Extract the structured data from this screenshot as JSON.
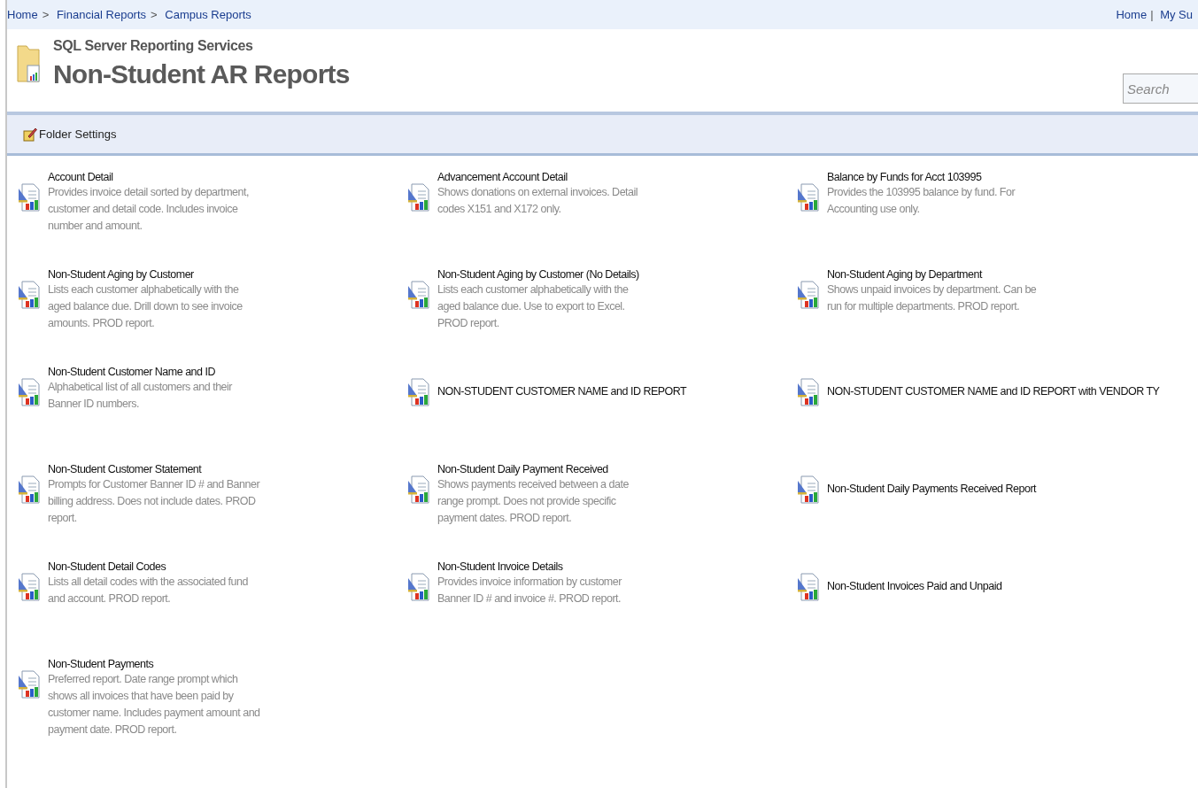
{
  "breadcrumb": [
    {
      "label": "Home"
    },
    {
      "label": "Financial Reports"
    },
    {
      "label": "Campus Reports"
    }
  ],
  "breadcrumb_separator": ">",
  "top_links": [
    {
      "label": "Home"
    },
    {
      "label": "My Su"
    }
  ],
  "top_link_separator": "|",
  "header": {
    "subtitle": "SQL Server Reporting Services",
    "title": "Non-Student AR Reports"
  },
  "search": {
    "placeholder": "Search"
  },
  "toolbar": {
    "button": "Folder Settings"
  },
  "reports": [
    {
      "name": "Account Detail",
      "description": "Provides invoice detail sorted by department, customer and detail code. Includes invoice number and amount."
    },
    {
      "name": "Advancement Account Detail",
      "description": "Shows donations on external invoices. Detail codes X151 and X172 only."
    },
    {
      "name": "Balance by Funds for Acct 103995",
      "description": "Provides the 103995 balance by fund. For Accounting use only."
    },
    {
      "name": "Non-Student Aging by Customer",
      "description": "Lists each customer alphabetically with the aged balance due. Drill down to see invoice amounts. PROD report."
    },
    {
      "name": "Non-Student Aging by Customer (No Details)",
      "description": "Lists each customer alphabetically with the aged balance due. Use to export to Excel. PROD report."
    },
    {
      "name": "Non-Student Aging by Department",
      "description": "Shows unpaid invoices by department. Can be run for multiple departments. PROD report."
    },
    {
      "name": "Non-Student Customer Name and ID",
      "description": "Alphabetical list of all customers and their Banner ID numbers."
    },
    {
      "name": "NON-STUDENT CUSTOMER NAME and ID REPORT"
    },
    {
      "name": "NON-STUDENT CUSTOMER NAME and ID REPORT with VENDOR TY"
    },
    {
      "name": "Non-Student Customer Statement",
      "description": "Prompts for Customer Banner ID # and Banner billing address. Does not include dates. PROD report."
    },
    {
      "name": "Non-Student Daily Payment Received",
      "description": "Shows payments received between a date range prompt. Does not provide specific payment dates. PROD report."
    },
    {
      "name": "Non-Student Daily Payments Received Report"
    },
    {
      "name": "Non-Student Detail Codes",
      "description": "Lists all detail codes with the associated fund and account. PROD report."
    },
    {
      "name": "Non-Student Invoice Details",
      "description": "Provides invoice information by customer Banner ID # and invoice #. PROD report."
    },
    {
      "name": "Non-Student Invoices Paid and Unpaid"
    },
    {
      "name": "Non-Student Payments",
      "description": "Preferred report. Date range prompt which shows all invoices that have been paid by customer name. Includes payment amount and payment date. PROD report."
    }
  ]
}
